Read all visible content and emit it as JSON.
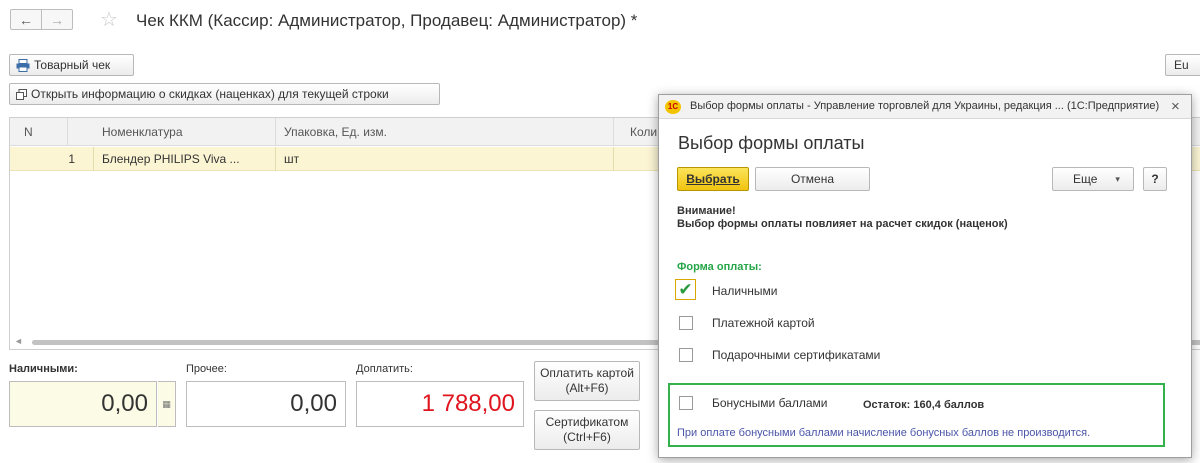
{
  "header": {
    "back_icon": "←",
    "forward_icon": "→",
    "star_icon": "☆",
    "title": "Чек ККМ (Кассир: Администратор, Продавец: Администратор) *"
  },
  "toolbar": {
    "receipt_label": "Товарный чек",
    "more_label": "Eu",
    "discounts_label": "Открыть информацию о скидках (наценках) для текущей строки"
  },
  "table": {
    "columns": [
      "N",
      "Номенклатура",
      "Упаковка, Ед. изм.",
      "Коли"
    ],
    "rows": [
      {
        "n": "1",
        "item": "Блендер PHILIPS Viva ...",
        "unit": "шт"
      }
    ]
  },
  "totals": {
    "cash_label": "Наличными:",
    "cash_value": "0,00",
    "other_label": "Прочее:",
    "other_value": "0,00",
    "pay_label": "Доплатить:",
    "pay_value": "1 788,00",
    "pay_color": "#e0141e",
    "pay_card_line1": "Оплатить картой",
    "pay_card_line2": "(Alt+F6)",
    "cert_line1": "Сертификатом",
    "cert_line2": "(Ctrl+F6)"
  },
  "dialog": {
    "logo": "1С",
    "title_bar": "Выбор формы оплаты - Управление торговлей для Украины, редакция ... (1С:Предприятие)",
    "close_icon": "×",
    "heading": "Выбор формы оплаты",
    "choose_button": "Выбрать",
    "cancel_button": "Отмена",
    "more_button": "Еще",
    "more_arrow": "▾",
    "help_button": "?",
    "warning_title": "Внимание!",
    "warning_text": "Выбор формы оплаты повлияет на расчет скидок (наценок)",
    "payment_form_label": "Форма оплаты:",
    "options": [
      {
        "label": "Наличными",
        "checked": true
      },
      {
        "label": "Платежной картой",
        "checked": false
      },
      {
        "label": "Подарочными сертификатами",
        "checked": false
      },
      {
        "label": "Бонусными баллами",
        "checked": false
      }
    ],
    "bonus_balance": "Остаток: 160,4 баллов",
    "bonus_note": "При оплате бонусными баллами начисление бонусных баллов не производится.",
    "accent_color": "#34b14a"
  }
}
